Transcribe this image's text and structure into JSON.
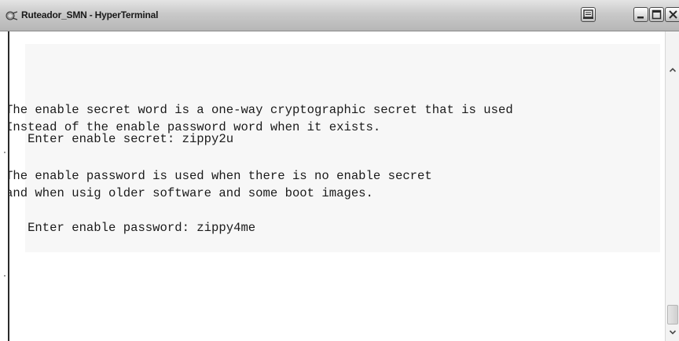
{
  "window": {
    "title": "Ruteador_SMN - HyperTerminal",
    "app_icon": "hyperterminal-icon",
    "controls": [
      "print-icon",
      "minimize-icon",
      "maximize-icon",
      "close-icon"
    ]
  },
  "terminal": {
    "lines": [
      "The enable secret word is a one-way cryptographic secret that is used",
      "Instead of the enable password word when it exists.",
      "",
      "   Enter enable secret: zippy2u",
      "",
      "The enable password is used when there is no enable secret",
      "and when usig older software and some boot images.",
      "",
      "   Enter enable password: zippy4me"
    ]
  },
  "colors": {
    "titlebar": "#c9c9c9",
    "terminal_background": "#ffffff",
    "terminal_text": "#1a1a1a"
  }
}
